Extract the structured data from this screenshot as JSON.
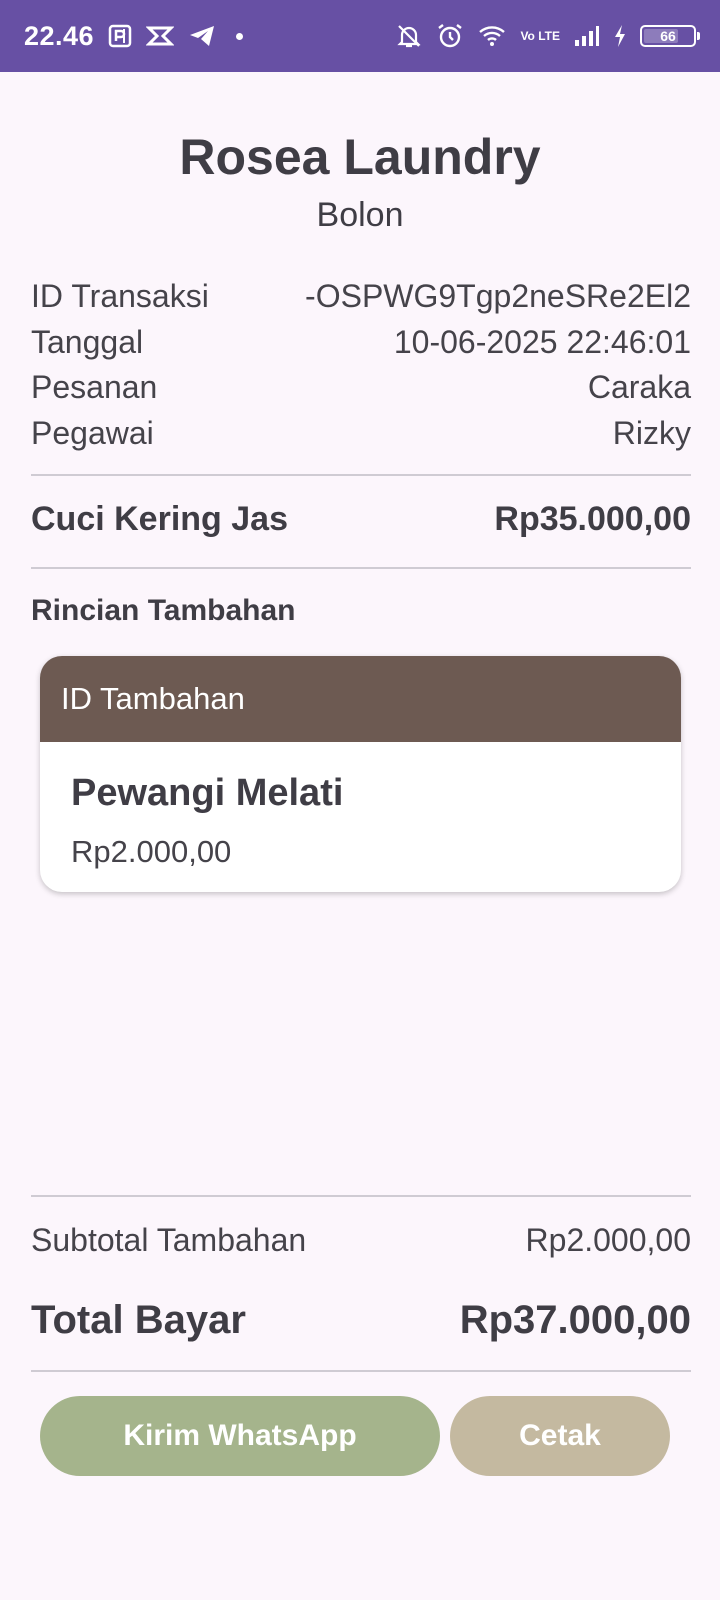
{
  "status_bar": {
    "time": "22.46",
    "battery_level": "66",
    "network": "Vo LTE",
    "icons": [
      "parking-icon",
      "capcut-icon",
      "telegram-icon",
      "dot-icon",
      "bell-off-icon",
      "alarm-icon",
      "wifi-icon",
      "signal-icon",
      "charging-icon",
      "battery-icon"
    ]
  },
  "header": {
    "shop_name": "Rosea Laundry",
    "branch": "Bolon"
  },
  "transaction": {
    "rows": [
      {
        "label": "ID Transaksi",
        "value": "-OSPWG9Tgp2neSRe2El2"
      },
      {
        "label": "Tanggal",
        "value": "10-06-2025 22:46:01"
      },
      {
        "label": "Pesanan",
        "value": "Caraka"
      },
      {
        "label": "Pegawai",
        "value": "Rizky"
      }
    ]
  },
  "service": {
    "name": "Cuci Kering Jas",
    "price": "Rp35.000,00"
  },
  "extras": {
    "section_title": "Rincian Tambahan",
    "items": [
      {
        "header": "ID Tambahan",
        "name": "Pewangi Melati",
        "price": "Rp2.000,00"
      }
    ]
  },
  "summary": {
    "subtotal_label": "Subtotal Tambahan",
    "subtotal_value": "Rp2.000,00",
    "total_label": "Total Bayar",
    "total_value": "Rp37.000,00"
  },
  "actions": {
    "whatsapp_label": "Kirim WhatsApp",
    "print_label": "Cetak"
  },
  "colors": {
    "status_bar": "#6750a4",
    "background": "#fcf6fc",
    "card_header": "#6d5a52",
    "whatsapp_button": "#a5b48c",
    "print_button": "#c4b9a0"
  }
}
